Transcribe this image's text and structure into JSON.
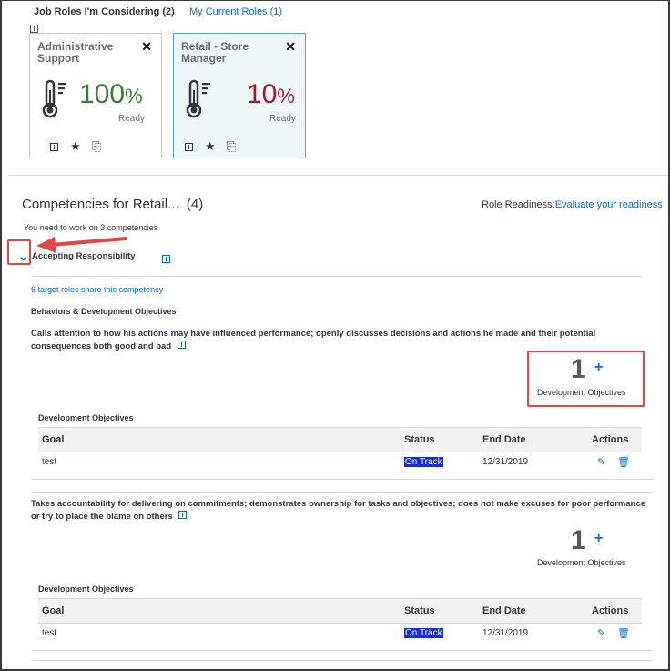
{
  "tabs": [
    {
      "label": "Job Roles I'm Considering (2)"
    },
    {
      "label": "My Current Roles (1)"
    }
  ],
  "roles": [
    {
      "title": "Administrative Support",
      "percent": "100",
      "percent_sign": "%",
      "status": "Ready",
      "color": "#3b7b3b"
    },
    {
      "title": "Retail - Store Manager",
      "percent": "10",
      "percent_sign": "%",
      "status": "Ready",
      "color": "#9b1c2e"
    }
  ],
  "competencies": {
    "title": "Competencies for Retail...",
    "count": "(4)",
    "readiness_label": "Role Readiness:",
    "readiness_link": "Evaluate your readiness",
    "summary": "You need to work on 3 competencies"
  },
  "competency": {
    "name": "Accepting Responsibility",
    "share_link": "6 target roles share this competency",
    "section_title": "Behaviors & Development Objectives"
  },
  "behaviors": [
    {
      "description": "Calls attention to how his actions may have influenced performance; openly discusses decisions and actions he made and their potential consequences both good and bad",
      "objectives_count": "1",
      "objectives_label": "Development Objectives",
      "table_title": "Development Objectives",
      "columns": [
        "Goal",
        "Status",
        "End Date",
        "Actions"
      ],
      "rows": [
        {
          "goal": "test",
          "status": "On Track",
          "end_date": "12/31/2019"
        }
      ]
    },
    {
      "description": "Takes accountability for delivering on commitments; demonstrates ownership for tasks and objectives; does not make excuses for poor performance or try to place the blame on others",
      "objectives_count": "1",
      "objectives_label": "Development Objectives",
      "table_title": "Development Objectives",
      "columns": [
        "Goal",
        "Status",
        "End Date",
        "Actions"
      ],
      "rows": [
        {
          "goal": "test",
          "status": "On Track",
          "end_date": "12/31/2019"
        }
      ]
    }
  ],
  "colors": {
    "accent": "#0a6ed1",
    "annotation": "#e04848",
    "ready_green": "#3b7b3b",
    "ready_red": "#9b1c2e"
  }
}
